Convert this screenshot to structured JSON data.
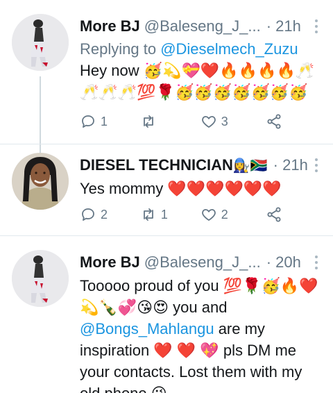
{
  "tweets": [
    {
      "name": "More BJ",
      "handle": "@Baleseng_J_...",
      "time": "· 21h",
      "replying_prefix": "Replying to ",
      "replying_to": "@Dieselmech_Zuzu",
      "text_line1": "Hey now 🥳💫💝❤️🔥🔥🔥🔥🥂",
      "text_line2": "🥂🥂🥂💯🌹🥳🥳🥳🥳🥳🥳🥳",
      "replies": "1",
      "retweets": "",
      "likes": "3"
    },
    {
      "name": "DIESEL TECHNICIAN",
      "name_emoji": "👩‍🔧🇿🇦",
      "time": "· 21h",
      "text": "Yes mommy ❤️❤️❤️❤️❤️❤️",
      "replies": "2",
      "retweets": "1",
      "likes": "2"
    },
    {
      "name": "More BJ",
      "handle": "@Baleseng_J_...",
      "time": "· 20h",
      "line1": "Tooooo proud of you 💯🌹🥳🔥❤️",
      "line2": "💫🍾💞😘😍 you and",
      "mention": "@Bongs_Mahlangu",
      "line3_rest": " are my",
      "line4": "inspiration ❤️ ❤️ 💖  pls DM me",
      "line5": "your contacts. Lost them with my",
      "line6": "old phone 😘"
    }
  ],
  "icons": {
    "reply": "reply-icon",
    "retweet": "retweet-icon",
    "like": "heart-icon",
    "share": "share-icon",
    "more": "more-vertical-icon"
  },
  "colors": {
    "link": "#1b95e0",
    "secondary_text": "#657786",
    "divider": "#e1e8ed"
  }
}
